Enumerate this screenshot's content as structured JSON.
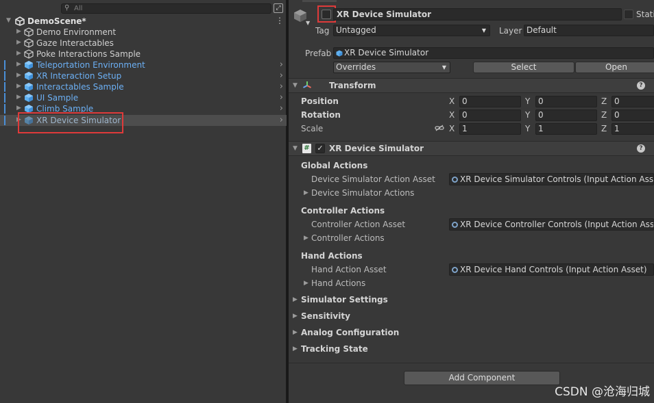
{
  "hierarchy": {
    "search_placeholder": "All",
    "scene_name": "DemoScene*",
    "items": [
      {
        "label": "Demo Environment",
        "style": "normal"
      },
      {
        "label": "Gaze Interactables",
        "style": "normal"
      },
      {
        "label": "Poke Interactions Sample",
        "style": "normal"
      },
      {
        "label": "Teleportation Environment",
        "style": "prefab"
      },
      {
        "label": "XR Interaction Setup",
        "style": "prefab"
      },
      {
        "label": "Interactables Sample",
        "style": "prefab"
      },
      {
        "label": "UI Sample",
        "style": "prefab"
      },
      {
        "label": "Climb Sample",
        "style": "prefab"
      },
      {
        "label": "XR Device Simulator",
        "style": "disabled-selected"
      }
    ]
  },
  "inspector": {
    "object_name": "XR Device Simulator",
    "static_label": "Stati",
    "tag_label": "Tag",
    "tag_value": "Untagged",
    "layer_label": "Layer",
    "layer_value": "Default",
    "prefab_label": "Prefab",
    "prefab_value": "XR Device Simulator",
    "overrides_label": "Overrides",
    "select_label": "Select",
    "open_label": "Open",
    "transform": {
      "title": "Transform",
      "position_label": "Position",
      "rotation_label": "Rotation",
      "scale_label": "Scale",
      "axis_x": "X",
      "axis_y": "Y",
      "axis_z": "Z",
      "position": [
        "0",
        "0",
        "0"
      ],
      "rotation": [
        "0",
        "0",
        "0"
      ],
      "scale": [
        "1",
        "1",
        "1"
      ]
    },
    "simulator": {
      "title": "XR Device Simulator",
      "global_actions": "Global Actions",
      "device_asset_label": "Device Simulator Action Asset",
      "device_asset_value": "XR Device Simulator Controls (Input Action Asset)",
      "device_actions": "Device Simulator Actions",
      "controller_actions_header": "Controller Actions",
      "controller_asset_label": "Controller Action Asset",
      "controller_asset_value": "XR Device Controller Controls (Input Action Asset)",
      "controller_actions": "Controller Actions",
      "hand_actions_header": "Hand Actions",
      "hand_asset_label": "Hand Action Asset",
      "hand_asset_value": "XR Device Hand Controls (Input Action Asset)",
      "hand_actions": "Hand Actions",
      "sections": [
        "Simulator Settings",
        "Sensitivity",
        "Analog Configuration",
        "Tracking State"
      ]
    },
    "add_component": "Add Component"
  },
  "watermark": "CSDN @沧海归城",
  "colors": {
    "prefab_blue": "#6cb0f5",
    "highlight_red": "#e03a3a",
    "panel_bg": "#383838"
  }
}
